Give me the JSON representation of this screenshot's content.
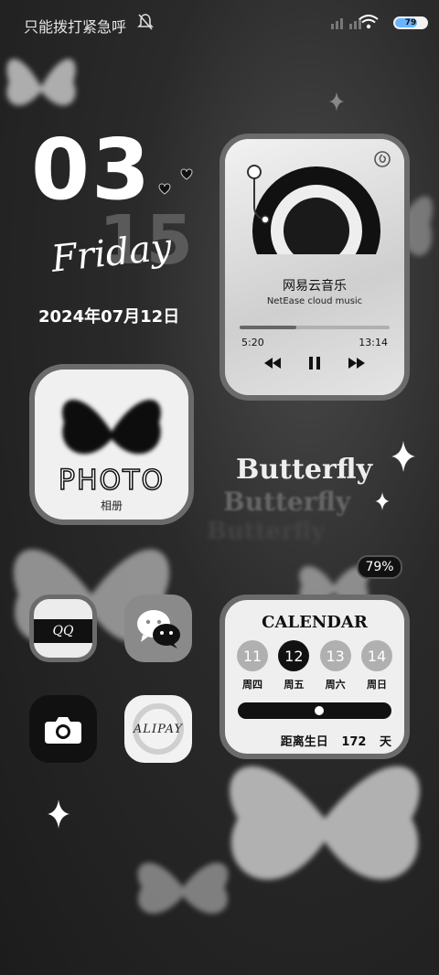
{
  "status_bar": {
    "carrier": "只能拨打紧急呼",
    "battery_badge": "79"
  },
  "clock_widget": {
    "day": "03",
    "month": "15",
    "weekday": "Friday",
    "full_date": "2024年07月12日"
  },
  "music_widget": {
    "song": "网易云音乐",
    "artist": "NetEase cloud music",
    "current_time": "5:20",
    "total_time": "13:14",
    "progress": 0.38
  },
  "photo_widget": {
    "title": "PHOTO",
    "subtitle": "相册"
  },
  "decor_text": {
    "line1": "Butterfly",
    "line2": "Butterfly",
    "line3": "Butterfly"
  },
  "battery_widget": {
    "percent": "79%"
  },
  "apps": {
    "qq": "QQ",
    "alipay": "ALIPAY"
  },
  "calendar_widget": {
    "title": "CALENDAR",
    "days": [
      {
        "num": "11",
        "weekday": "周四",
        "active": false
      },
      {
        "num": "12",
        "weekday": "周五",
        "active": true
      },
      {
        "num": "13",
        "weekday": "周六",
        "active": false
      },
      {
        "num": "14",
        "weekday": "周日",
        "active": false
      }
    ],
    "progress": 0.53,
    "countdown_label": "距离生日",
    "countdown_value": "172",
    "countdown_unit": "天"
  }
}
